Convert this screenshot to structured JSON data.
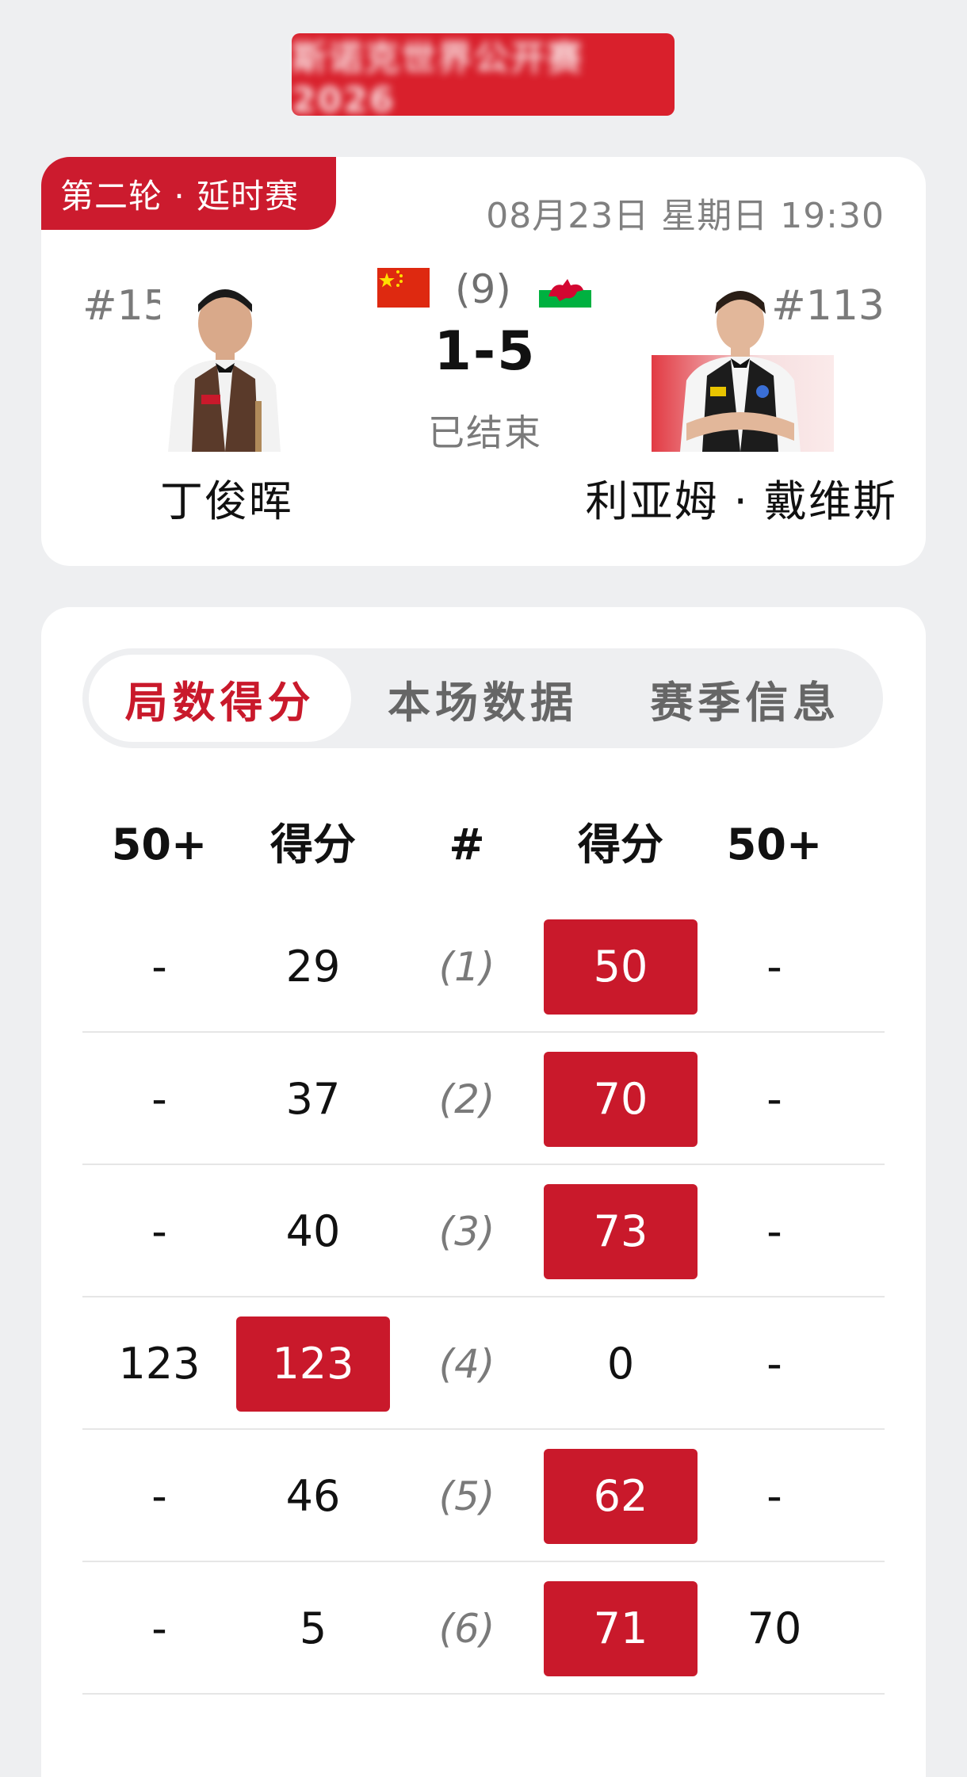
{
  "banner": {
    "text": "斯诺克世界公开赛2026"
  },
  "match": {
    "round_badge": "第二轮 · 延时赛",
    "datetime": "08月23日 星期日 19:30",
    "best_of": "(9)",
    "score": "1-5",
    "status": "已结束",
    "left_player": {
      "rank": "#15",
      "name": "丁俊晖",
      "flag": "china-flag"
    },
    "right_player": {
      "rank": "#113",
      "name": "利亚姆 · 戴维斯",
      "flag": "wales-flag"
    }
  },
  "tabs": [
    {
      "label": "局数得分",
      "active": true
    },
    {
      "label": "本场数据",
      "active": false
    },
    {
      "label": "赛季信息",
      "active": false
    }
  ],
  "table": {
    "headers": [
      "50+",
      "得分",
      "#",
      "得分",
      "50+"
    ],
    "rows": [
      {
        "left_break": "-",
        "left_score": "29",
        "frame": "(1)",
        "right_score": "50",
        "right_break": "-",
        "winner": "right"
      },
      {
        "left_break": "-",
        "left_score": "37",
        "frame": "(2)",
        "right_score": "70",
        "right_break": "-",
        "winner": "right"
      },
      {
        "left_break": "-",
        "left_score": "40",
        "frame": "(3)",
        "right_score": "73",
        "right_break": "-",
        "winner": "right"
      },
      {
        "left_break": "123",
        "left_score": "123",
        "frame": "(4)",
        "right_score": "0",
        "right_break": "-",
        "winner": "left"
      },
      {
        "left_break": "-",
        "left_score": "46",
        "frame": "(5)",
        "right_score": "62",
        "right_break": "-",
        "winner": "right"
      },
      {
        "left_break": "-",
        "left_score": "5",
        "frame": "(6)",
        "right_score": "71",
        "right_break": "70",
        "winner": "right"
      }
    ]
  },
  "colors": {
    "accent": "#c9192b",
    "background": "#eeeff1",
    "muted": "#7a7a7a"
  }
}
